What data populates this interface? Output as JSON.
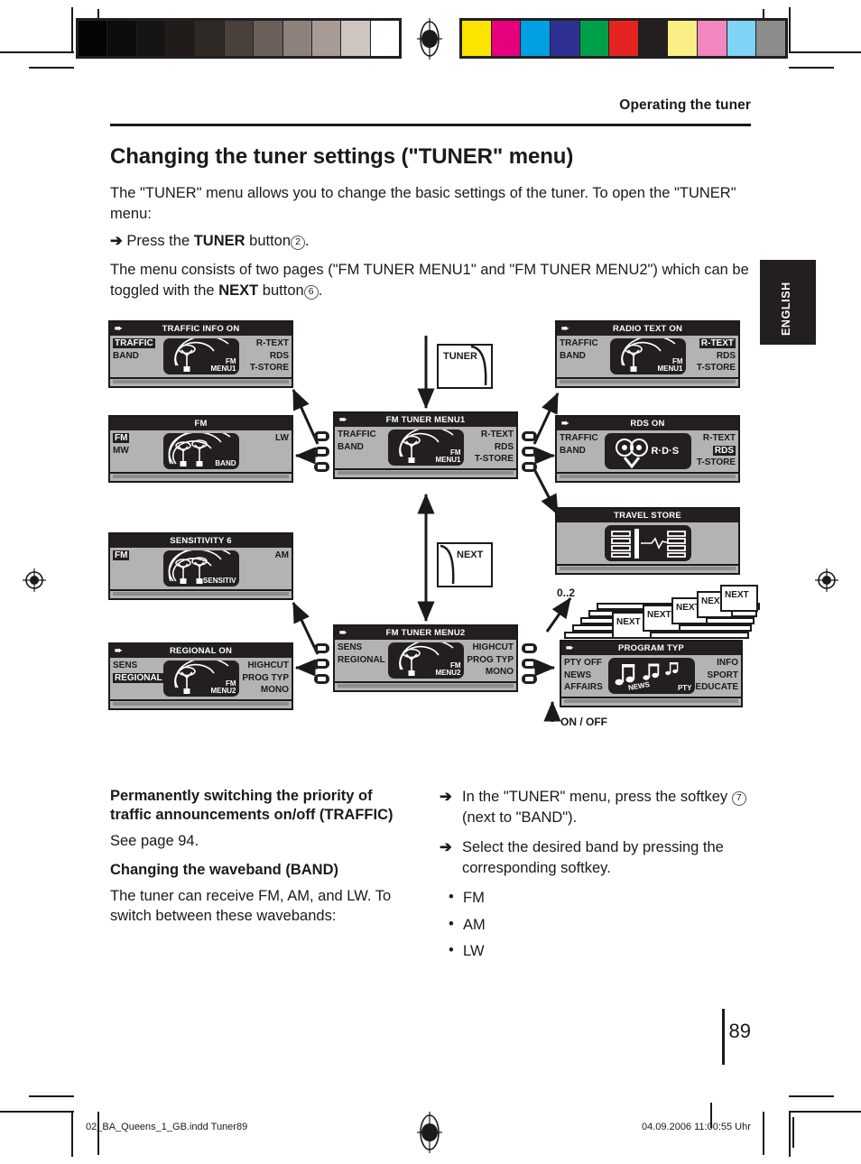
{
  "header": {
    "running_head": "Operating the tuner",
    "side_tab": "ENGLISH"
  },
  "intro": {
    "title": "Changing the tuner settings (\"TUNER\" menu)",
    "p1": "The \"TUNER\" menu allows you to change the basic settings of the tuner. To open the \"TUNER\" menu:",
    "step1_pre": "Press the",
    "step1_bold": "TUNER",
    "step1_mid": "button",
    "step1_num": "2",
    "p2_pre": "The menu consists of two pages (\"FM TUNER MENU1\" and \"FM TUNER MENU2\") which can be toggled with the",
    "p2_bold": "NEXT",
    "p2_post": "button",
    "p2_num": "6"
  },
  "diagram": {
    "callout_tuner": "TUNER",
    "callout_next": "NEXT",
    "note_range": "0..2",
    "note_onoff": "ON / OFF",
    "stack_labels": [
      "NEXT",
      "NEXT",
      "NEXT",
      "NEXT",
      "NEXT"
    ],
    "panels": {
      "traffic_info_on": {
        "title": "TRAFFIC INFO ON",
        "left": [
          "TRAFFIC",
          "BAND"
        ],
        "left_highlight": 0,
        "right": [
          "R-TEXT",
          "RDS",
          "T-STORE"
        ],
        "right_highlight": -1,
        "tile_mode": "antenna",
        "tile_label_top": "FM",
        "tile_label_bottom": "MENU1"
      },
      "fm": {
        "title": "FM",
        "left": [
          "FM",
          "MW"
        ],
        "left_highlight": 0,
        "right": [
          "LW"
        ],
        "right_highlight": -1,
        "tile_mode": "antenna2",
        "tile_label_top": "",
        "tile_label_bottom": "BAND"
      },
      "fm_tuner_menu1": {
        "title": "FM TUNER MENU1",
        "left": [
          "TRAFFIC",
          "BAND"
        ],
        "left_highlight": -1,
        "right": [
          "R-TEXT",
          "RDS",
          "T-STORE"
        ],
        "right_highlight": -1,
        "tile_mode": "antenna",
        "tile_label_top": "FM",
        "tile_label_bottom": "MENU1"
      },
      "radio_text_on": {
        "title": "RADIO TEXT ON",
        "left": [
          "TRAFFIC",
          "BAND"
        ],
        "left_highlight": -1,
        "right": [
          "R-TEXT",
          "RDS",
          "T-STORE"
        ],
        "right_highlight": 0,
        "tile_mode": "antenna",
        "tile_label_top": "FM",
        "tile_label_bottom": "MENU1"
      },
      "rds_on": {
        "title": "RDS ON",
        "left": [
          "TRAFFIC",
          "BAND"
        ],
        "left_highlight": -1,
        "right": [
          "R-TEXT",
          "RDS",
          "T-STORE"
        ],
        "right_highlight": 1,
        "tile_mode": "rds",
        "tile_text": "R·D·S"
      },
      "travel_store": {
        "title": "TRAVEL STORE",
        "left": [],
        "right": [],
        "tile_mode": "tstore"
      },
      "sensitivity": {
        "title": "SENSITIVITY 6",
        "left": [
          "FM"
        ],
        "left_highlight": 0,
        "right": [
          "AM"
        ],
        "right_highlight": -1,
        "tile_mode": "antenna2",
        "tile_label_bottom": "SENSITIV"
      },
      "regional_on": {
        "title": "REGIONAL ON",
        "left": [
          "SENS",
          "REGIONAL"
        ],
        "left_highlight": 1,
        "right": [
          "HIGHCUT",
          "PROG TYP",
          "MONO"
        ],
        "right_highlight": -1,
        "tile_mode": "antenna",
        "tile_label_top": "FM",
        "tile_label_bottom": "MENU2"
      },
      "fm_tuner_menu2": {
        "title": "FM TUNER MENU2",
        "left": [
          "SENS",
          "REGIONAL"
        ],
        "left_highlight": -1,
        "right": [
          "HIGHCUT",
          "PROG TYP",
          "MONO"
        ],
        "right_highlight": -1,
        "tile_mode": "antenna",
        "tile_label_top": "FM",
        "tile_label_bottom": "MENU2"
      },
      "program_typ": {
        "title": "PROGRAM TYP",
        "left": [
          "PTY OFF",
          "NEWS",
          "AFFAIRS"
        ],
        "left_highlight": -1,
        "right": [
          "INFO",
          "SPORT",
          "EDUCATE"
        ],
        "right_highlight": -1,
        "tile_mode": "pty",
        "tile_label_bottom": "NEWS",
        "tile_label_corner": "PTY"
      }
    }
  },
  "bottom_left": {
    "heading1": "Permanently switching the priority of traffic announcements on/off (TRAFFIC)",
    "body1": "See page 94.",
    "heading2": "Changing the waveband (BAND)",
    "body2": "The tuner can receive FM, AM, and LW. To switch between these wavebands:"
  },
  "bottom_right": {
    "step1_a": "In the \"TUNER\" menu, press the softkey",
    "step1_num": "7",
    "step1_b": "(next to \"BAND\").",
    "step2": "Select the desired band by pressing the corresponding softkey.",
    "bullets": [
      "FM",
      "AM",
      "LW"
    ]
  },
  "page": {
    "number": "89",
    "footer_left": "02_BA_Queens_1_GB.indd   Tuner89",
    "footer_right": "04.09.2006   11:00:55 Uhr"
  },
  "calibration": {
    "gray_swatches": [
      "#050505",
      "#0e0c0c",
      "#171414",
      "#211c1a",
      "#2f2926",
      "#4a403c",
      "#6b5f5a",
      "#8d817c",
      "#a89b96",
      "#cfc5c0",
      "#ffffff"
    ],
    "color_swatches": [
      "#fbe400",
      "#e6007e",
      "#00a0e3",
      "#2e3192",
      "#00a04a",
      "#e52421",
      "#231f20",
      "#faef87",
      "#f287c0",
      "#7fd4f5",
      "#8c8c8c"
    ]
  }
}
